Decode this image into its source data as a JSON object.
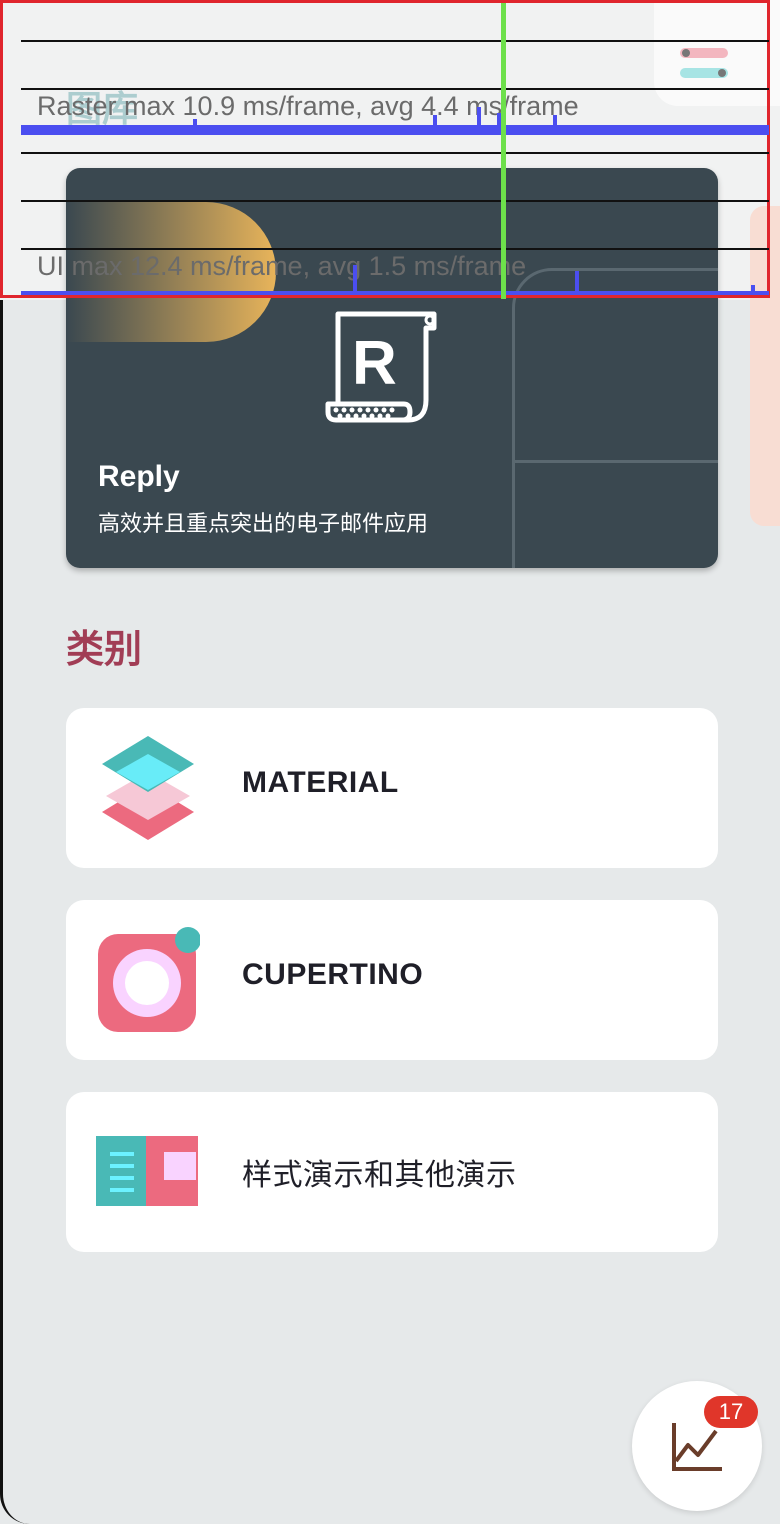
{
  "header": {
    "gallery_title": "图库",
    "settings_icon": "settings-toggle-icon"
  },
  "featured": {
    "title": "Reply",
    "subtitle": "高效并且重点突出的电子邮件应用",
    "logo_icon": "reply-logo-icon",
    "logo_letter": "R"
  },
  "perf_overlay": {
    "raster_label": "Raster  max 10.9 ms/frame, avg 4.4 ms/frame",
    "ui_label": "UI  max 12.4 ms/frame, avg 1.5 ms/frame",
    "bar_color": "#4b4ef0",
    "cursor_color": "#6de04b",
    "border_color": "#e0262d"
  },
  "categories": {
    "section_title": "类别",
    "items": [
      {
        "label": "MATERIAL",
        "icon": "material-icon"
      },
      {
        "label": "CUPERTINO",
        "icon": "cupertino-icon"
      },
      {
        "label": "样式演示和其他演示",
        "icon": "other-demos-icon"
      }
    ]
  },
  "fab": {
    "icon": "chart-icon",
    "badge": "17"
  },
  "colors": {
    "accent": "#a13d55",
    "card_dark": "#3a4850",
    "background": "#e6e9ea"
  }
}
